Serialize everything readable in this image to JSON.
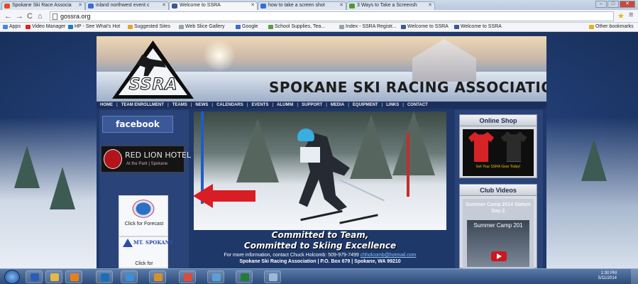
{
  "browser": {
    "tabs": [
      {
        "title": "Spokane Ski Race Associa",
        "color": "#e24a2b"
      },
      {
        "title": "inland northwest event c",
        "color": "#3b6bd6"
      },
      {
        "title": "Welcome to SSRA",
        "color": "#3a5a96"
      },
      {
        "title": "how to take a screen shot",
        "color": "#3b6bd6"
      },
      {
        "title": "3 Ways to Take a Screensh",
        "color": "#4a9a3c"
      }
    ],
    "url": "gossra.org",
    "bookmarks": [
      {
        "label": "Apps",
        "color": "#4285f4"
      },
      {
        "label": "Video Manager",
        "color": "#e62117"
      },
      {
        "label": "HP - See What's Hot",
        "color": "#1e7ac8"
      },
      {
        "label": "Suggested Sites",
        "color": "#e8a12d"
      },
      {
        "label": "Web Slice Gallery",
        "color": "#9aa0a8"
      },
      {
        "label": "Google",
        "color": "#3b6bd6"
      },
      {
        "label": "School Supplies, Tea...",
        "color": "#5b9b3c"
      },
      {
        "label": "Index - SSRA Registr...",
        "color": "#9aa0a8"
      },
      {
        "label": "Welcome to SSRA",
        "color": "#3a5a96"
      },
      {
        "label": "Welcome to SSRA",
        "color": "#3a5a96"
      }
    ],
    "other_bookmarks": "Other bookmarks"
  },
  "site": {
    "logo_text": "SSRA",
    "title": "SPOKANE SKI RACING ASSOCIATION",
    "nav": [
      "HOME",
      "TEAM ENROLLMENT",
      "TEAMS",
      "NEWS",
      "CALENDARS",
      "EVENTS",
      "ALUMNI",
      "SUPPORT",
      "MEDIA",
      "EQUIPMENT",
      "LINKS",
      "CONTACT"
    ],
    "facebook": "facebook",
    "sponsor": {
      "name": "RED LION HOTEL",
      "sub": "At the Park | Spokane"
    },
    "weather": {
      "label": "Click for Forecast"
    },
    "mt_spokane": {
      "brand": "MT. SPOKANE",
      "label": "Click for"
    },
    "tagline_1": "Committed to Team,",
    "tagline_2": "Committed to Skiing Excellence",
    "contact_prefix": "For more information, contact Chuck Holcomb: 509-979-7499",
    "contact_email": "chholcomb@hotmail.com",
    "address": "Spokane Ski Racing Association | P.O. Box 679 | Spokane, WA 99210",
    "online_shop": {
      "title": "Online Shop",
      "caption": "Get Your SSRA Gear Today!"
    },
    "club_videos": {
      "title": "Club Videos",
      "video_title": "Summer Camp 2014 Slalom Day 2",
      "thumb_title": "Summer Camp 201"
    }
  },
  "taskbar": {
    "time": "1:30 PM",
    "date": "5/11/2014",
    "apps": [
      {
        "name": "word",
        "color": "#2b5eb3"
      },
      {
        "name": "explorer",
        "color": "#e6b842"
      },
      {
        "name": "media-player",
        "color": "#e7801a"
      },
      {
        "name": "hp",
        "color": "#1a6fb9"
      },
      {
        "name": "mail",
        "color": "#3a8fd8"
      },
      {
        "name": "photos",
        "color": "#d6902a"
      },
      {
        "name": "chrome",
        "color": "#dd4a3a"
      },
      {
        "name": "network",
        "color": "#5b9fd6"
      },
      {
        "name": "excel",
        "color": "#237a3d"
      },
      {
        "name": "paint",
        "color": "#9ab8da"
      }
    ]
  }
}
